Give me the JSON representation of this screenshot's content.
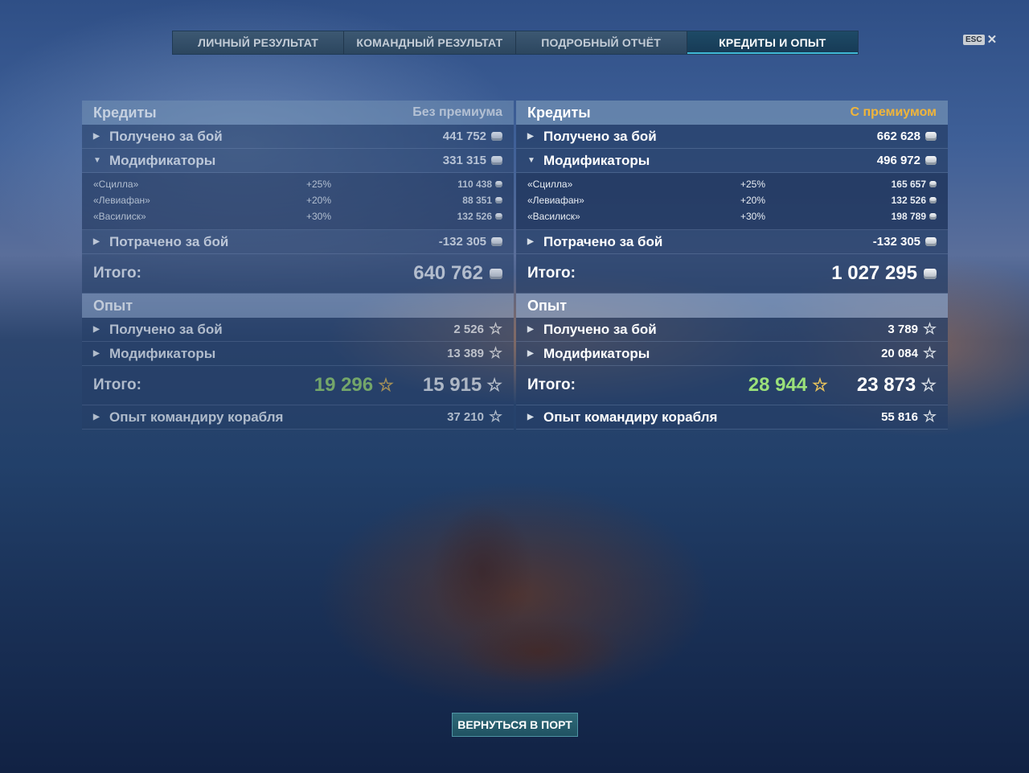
{
  "tabs": [
    "ЛИЧНЫЙ РЕЗУЛЬТАТ",
    "КОМАНДНЫЙ РЕЗУЛЬТАТ",
    "ПОДРОБНЫЙ ОТЧЁТ",
    "КРЕДИТЫ И ОПЫТ"
  ],
  "esc_label": "ESC",
  "close_glyph": "✕",
  "left": {
    "credits_title": "Кредиты",
    "mode": "Без премиума",
    "earned_label": "Получено за бой",
    "earned_value": "441 752",
    "mods_label": "Модификаторы",
    "mods_value": "331 315",
    "modifiers": [
      {
        "name": "«Сцилла»",
        "pct": "+25%",
        "value": "110 438"
      },
      {
        "name": "«Левиафан»",
        "pct": "+20%",
        "value": "88 351"
      },
      {
        "name": "«Василиск»",
        "pct": "+30%",
        "value": "132 526"
      }
    ],
    "spent_label": "Потрачено за бой",
    "spent_value": "-132 305",
    "total_label": "Итого:",
    "total_value": "640 762",
    "exp_title": "Опыт",
    "exp_earned_label": "Получено за бой",
    "exp_earned_value": "2 526",
    "exp_mods_label": "Модификаторы",
    "exp_mods_value": "13 389",
    "exp_total_label": "Итого:",
    "exp_total_free": "19 296",
    "exp_total_value": "15 915",
    "cmdr_label": "Опыт командиру корабля",
    "cmdr_value": "37 210"
  },
  "right": {
    "credits_title": "Кредиты",
    "mode": "С премиумом",
    "earned_label": "Получено за бой",
    "earned_value": "662 628",
    "mods_label": "Модификаторы",
    "mods_value": "496 972",
    "modifiers": [
      {
        "name": "«Сцилла»",
        "pct": "+25%",
        "value": "165 657"
      },
      {
        "name": "«Левиафан»",
        "pct": "+20%",
        "value": "132 526"
      },
      {
        "name": "«Василиск»",
        "pct": "+30%",
        "value": "198 789"
      }
    ],
    "spent_label": "Потрачено за бой",
    "spent_value": "-132 305",
    "total_label": "Итого:",
    "total_value": "1 027 295",
    "exp_title": "Опыт",
    "exp_earned_label": "Получено за бой",
    "exp_earned_value": "3 789",
    "exp_mods_label": "Модификаторы",
    "exp_mods_value": "20 084",
    "exp_total_label": "Итого:",
    "exp_total_free": "28 944",
    "exp_total_value": "23 873",
    "cmdr_label": "Опыт командиру корабля",
    "cmdr_value": "55 816"
  },
  "glyphs": {
    "arrow_right": "▶",
    "arrow_down": "▼",
    "star": "☆"
  },
  "return_button": "ВЕРНУТЬСЯ В ПОРТ",
  "colors": {
    "premium": "#f0b53a",
    "free_exp": "#9be07a",
    "tab_accent": "#3fb8d6"
  }
}
